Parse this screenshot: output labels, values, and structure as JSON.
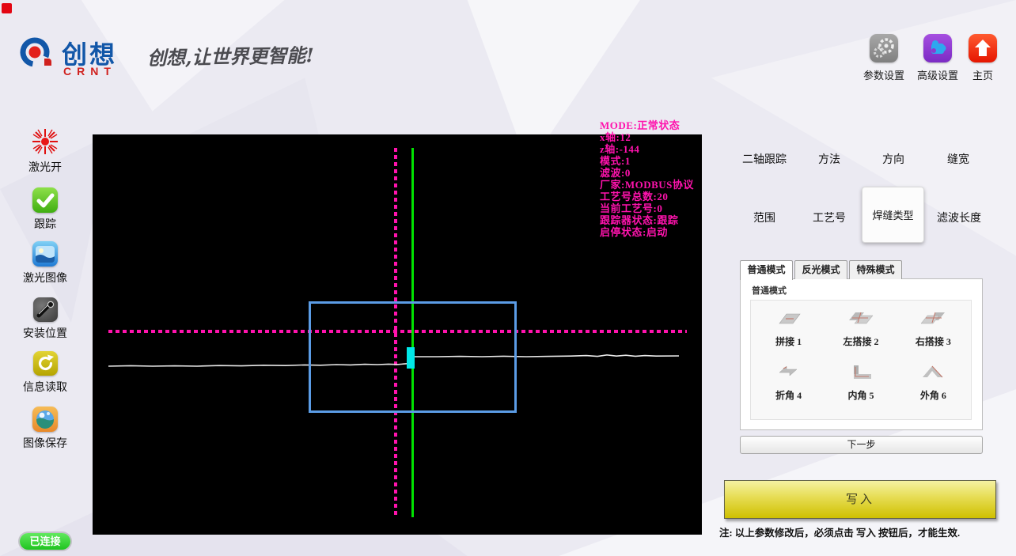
{
  "header": {
    "brand": {
      "name": "创想",
      "sub": "CRNT",
      "slogan": "创想,让世界更智能!"
    },
    "nav": [
      {
        "label": "参数设置",
        "icon": "gear-icon"
      },
      {
        "label": "高级设置",
        "icon": "puzzle-icon"
      },
      {
        "label": "主页",
        "icon": "home-icon"
      }
    ]
  },
  "sidebar": {
    "items": [
      {
        "label": "激光开",
        "icon": "laser-icon"
      },
      {
        "label": "跟踪",
        "icon": "check-icon"
      },
      {
        "label": "激光图像",
        "icon": "laser-image-icon"
      },
      {
        "label": "安装位置",
        "icon": "mount-position-icon"
      },
      {
        "label": "信息读取",
        "icon": "info-read-icon"
      },
      {
        "label": "图像保存",
        "icon": "image-save-icon"
      }
    ]
  },
  "canvas": {
    "overlay": {
      "title": "MODE:正常状态",
      "lines": [
        "x轴:12",
        "z轴:-144",
        "模式:1",
        "滤波:0",
        "厂家:MODBUS协议",
        "工艺号总数:20",
        "当前工艺号:0",
        "跟踪器状态:跟踪",
        "启停状态:启动"
      ]
    },
    "colors": {
      "overlay_text": "#ff13ad",
      "crosshair_dotted": "#ff13ad",
      "tracking_line": "#00e300",
      "roi_box": "#5b9ce6",
      "seam_marker": "#00e8e8",
      "profile_trace": "#e8e8e8",
      "background": "#000000"
    }
  },
  "params_nav": {
    "row1": [
      {
        "label": "二轴跟踪"
      },
      {
        "label": "方法"
      },
      {
        "label": "方向"
      },
      {
        "label": "缝宽"
      }
    ],
    "row2": [
      {
        "label": "范围"
      },
      {
        "label": "工艺号"
      },
      {
        "label": "焊缝类型"
      },
      {
        "label": "滤波长度"
      }
    ],
    "selected": "焊缝类型"
  },
  "mode_tabs": [
    {
      "label": "普通模式",
      "active": true
    },
    {
      "label": "反光模式",
      "active": false
    },
    {
      "label": "特殊模式",
      "active": false
    }
  ],
  "weld_panel": {
    "group_label": "普通模式",
    "types": [
      {
        "label": "拼接 1"
      },
      {
        "label": "左搭接 2"
      },
      {
        "label": "右搭接 3"
      },
      {
        "label": "折角 4"
      },
      {
        "label": "内角 5"
      },
      {
        "label": "外角 6"
      }
    ]
  },
  "buttons": {
    "next": "下一步",
    "write": "写入"
  },
  "note": "注: 以上参数修改后，必须点击 写入 按钮后，才能生效.",
  "status": {
    "connected": "已连接",
    "color": "#35d435"
  },
  "accent_colors": {
    "write_button": "#cfc000",
    "brand_blue": "#1257a8",
    "brand_red": "#d0211e"
  }
}
